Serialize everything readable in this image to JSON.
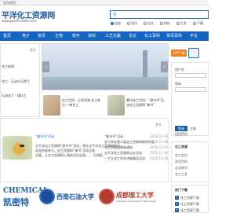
{
  "topbar": {
    "text": "设为首页"
  },
  "header": {
    "logo_cn": "平洋化工资源网",
    "logo_url": "www.pacificchem.com"
  },
  "search": {
    "placeholder": "",
    "options": [
      {
        "label": "全部",
        "checked": true
      },
      {
        "label": "资讯",
        "checked": false
      },
      {
        "label": "论文",
        "checked": false
      },
      {
        "label": "科技",
        "checked": false
      },
      {
        "label": "工艺",
        "checked": false
      },
      {
        "label": "下载",
        "checked": false
      }
    ]
  },
  "nav": {
    "items": [
      "首页",
      "电子",
      "资讯",
      "生物",
      "软件",
      "资料",
      "工艺文献",
      "论文",
      "化工百科",
      "资讯百科",
      "平台"
    ]
  },
  "left": {
    "more": "更多",
    "lines": [
      "化工新闻",
      "化工 · 石油与天然气",
      "石油化工 · 煤化工"
    ]
  },
  "banner": {
    "prev_icon": "chevron-left-icon",
    "next_icon": "chevron-right-icon"
  },
  "cards": [
    {
      "text": "化工百科：分享资源·化工知识·一种化工"
    },
    {
      "text": "腾讯化工百科：“课书书”石油化工资源网“课书”"
    }
  ],
  "news": {
    "more": "更多",
    "lead_title": "“鲁书书”活动",
    "para_lines": [
      "太平洋化工资源网“课书书”活动，将在太平洋化工资源网举行，",
      "欢迎积极参与。化工资源网“课书”活动全面",
      "开展，让化工资源网上线的活动全面，…【详细】"
    ],
    "headlines": [
      "“鲁书书”活动",
      "关于举办第二届化工资源网原创作品",
      "化工资源网更新通知",
      "太平洋化工资源网论文活动",
      "一工主化工系列讲座精品活动"
    ],
    "dates": [
      "2016-12-10",
      "2016-12-08",
      "2016-12-05",
      "2016-11-30",
      "2016-11-28"
    ]
  },
  "partners": {
    "chem_top": "CHEMICAL",
    "chem_bottom": "凯密特",
    "swu": "西南石油大学",
    "cdu": "成都理工大学",
    "cdu_en": "Chengdu University of Technology"
  },
  "right": {
    "app_button": "APP下载",
    "login_labels": [
      "用户名",
      "密码"
    ],
    "login_button": "登录",
    "login_links": [
      "注册",
      "找回密码"
    ],
    "section_title": "化工资源",
    "section_items": [
      "化工资讯",
      "资讯百科",
      "论文期刊",
      "化工工艺"
    ],
    "download_title": "热门下载",
    "downloads": [
      "化工资源下载",
      "化工资源下载",
      "化工资源下载"
    ],
    "colors": {
      "nav": "#1565c0",
      "app": "#f07f1c",
      "brand": "#1f5fa8"
    }
  }
}
